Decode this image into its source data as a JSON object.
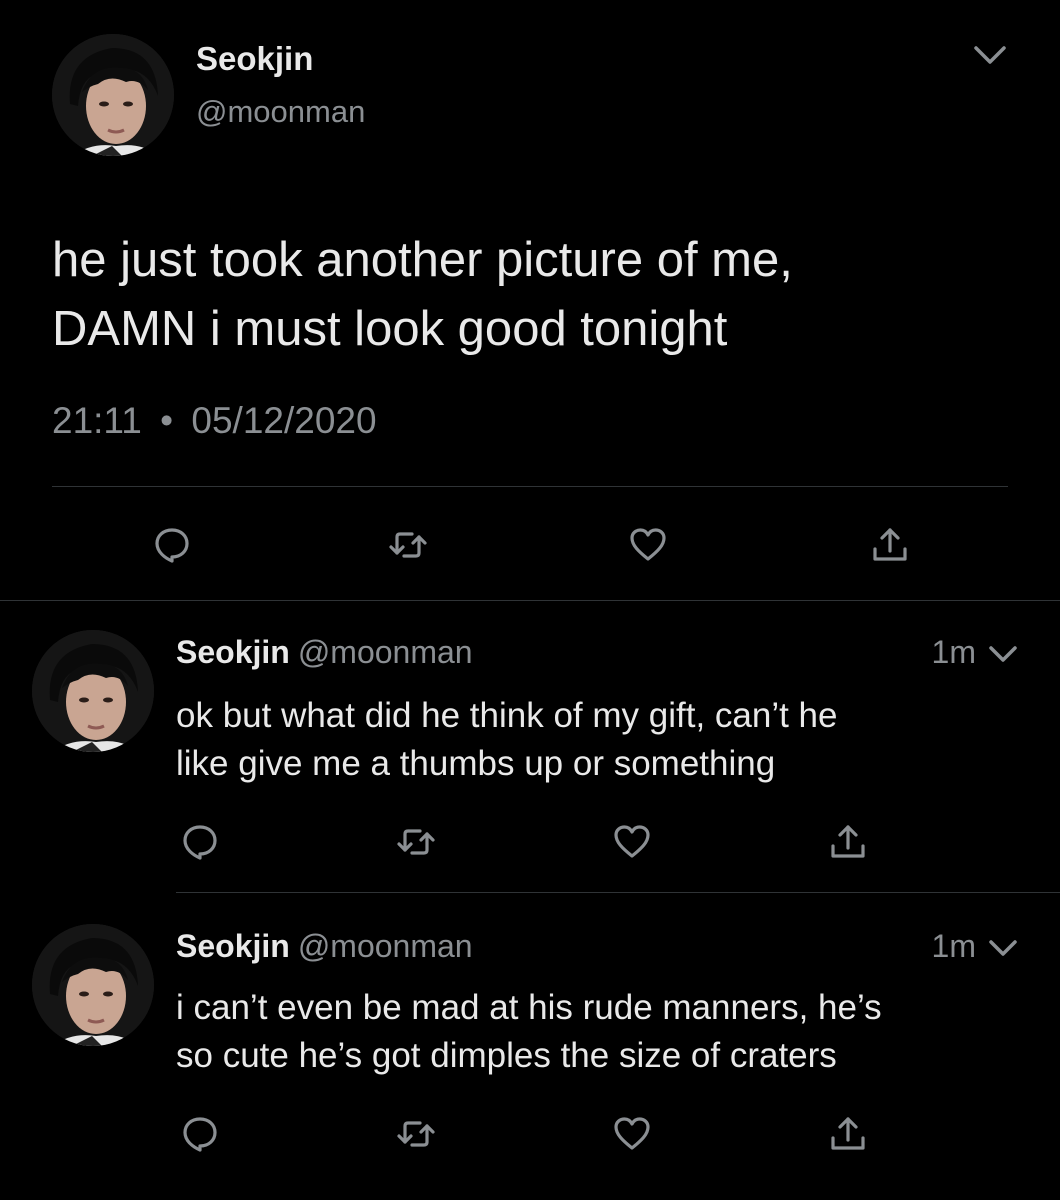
{
  "main_tweet": {
    "author_name": "Seokjin",
    "author_handle": "@moonman",
    "text_line1": "he just took another picture of me,",
    "text_line2": "DAMN i must look good tonight",
    "time": "21:11",
    "separator": "•",
    "date": "05/12/2020",
    "actions": [
      "reply-icon",
      "retweet-icon",
      "like-icon",
      "share-icon"
    ]
  },
  "replies": [
    {
      "author_name": "Seokjin",
      "author_handle": "@moonman",
      "time": "1m",
      "text_line1": "ok but what did he think of my gift, can’t he",
      "text_line2": "like give me a thumbs up or something"
    },
    {
      "author_name": "Seokjin",
      "author_handle": "@moonman",
      "time": "1m",
      "text_line1": "i can’t even be mad at his rude manners, he’s",
      "text_line2": "so cute he’s got dimples the size of craters"
    }
  ],
  "colors": {
    "background": "#000000",
    "text_primary": "#e9e9e9",
    "text_secondary": "#8b8f93",
    "divider": "#2f3336"
  }
}
